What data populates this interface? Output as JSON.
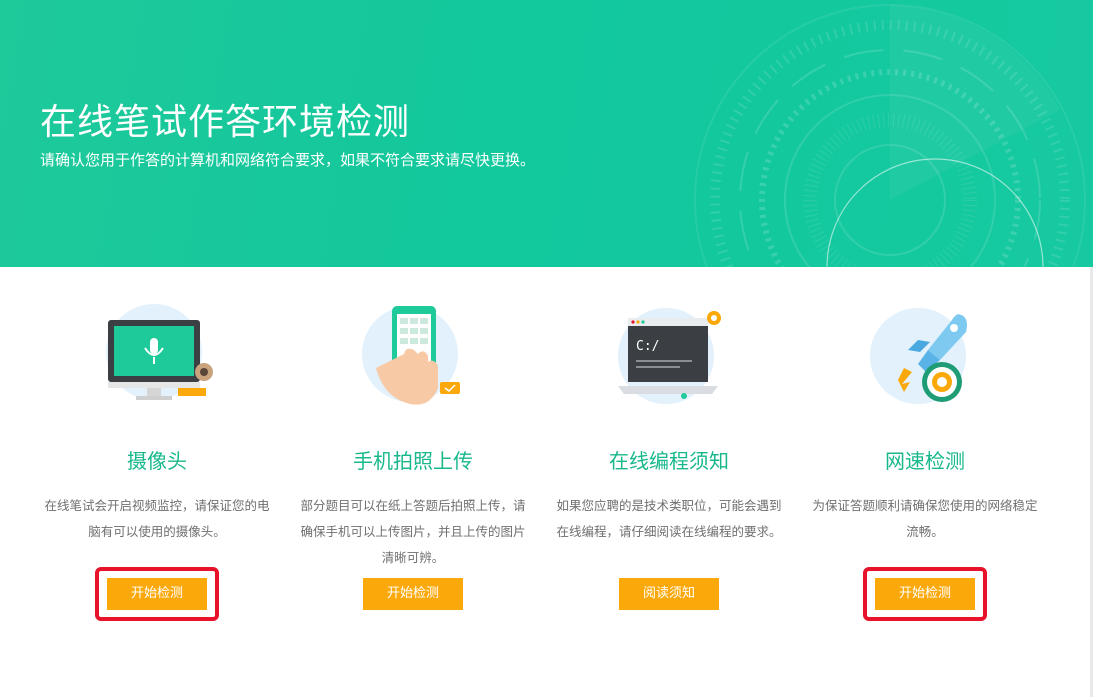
{
  "hero": {
    "title": "在线笔试作答环境检测",
    "subtitle": "请确认您用于作答的计算机和网络符合要求，如果不符合要求请尽快更换。"
  },
  "cards": [
    {
      "title": "摄像头",
      "desc": "在线笔试会开启视频监控，请保证您的电脑有可以使用的摄像头。",
      "button": "开始检测",
      "icon": "webcam-monitor-icon",
      "highlighted": true
    },
    {
      "title": "手机拍照上传",
      "desc": "部分题目可以在纸上答题后拍照上传，请确保手机可以上传图片，并且上传的图片清晰可辨。",
      "button": "开始检测",
      "icon": "phone-photo-icon",
      "highlighted": false
    },
    {
      "title": "在线编程须知",
      "desc": "如果您应聘的是技术类职位，可能会遇到在线编程，请仔细阅读在线编程的要求。",
      "button": "阅读须知",
      "icon": "laptop-code-icon",
      "icon_text": "C:/",
      "highlighted": false
    },
    {
      "title": "网速检测",
      "desc": "为保证答题顺利请确保您使用的网络稳定流畅。",
      "button": "开始检测",
      "icon": "rocket-target-icon",
      "highlighted": true
    }
  ],
  "colors": {
    "hero_bg": "#16c9a0",
    "title_green": "#18b88c",
    "button_orange": "#fba90a",
    "highlight_red": "#e8132a"
  }
}
